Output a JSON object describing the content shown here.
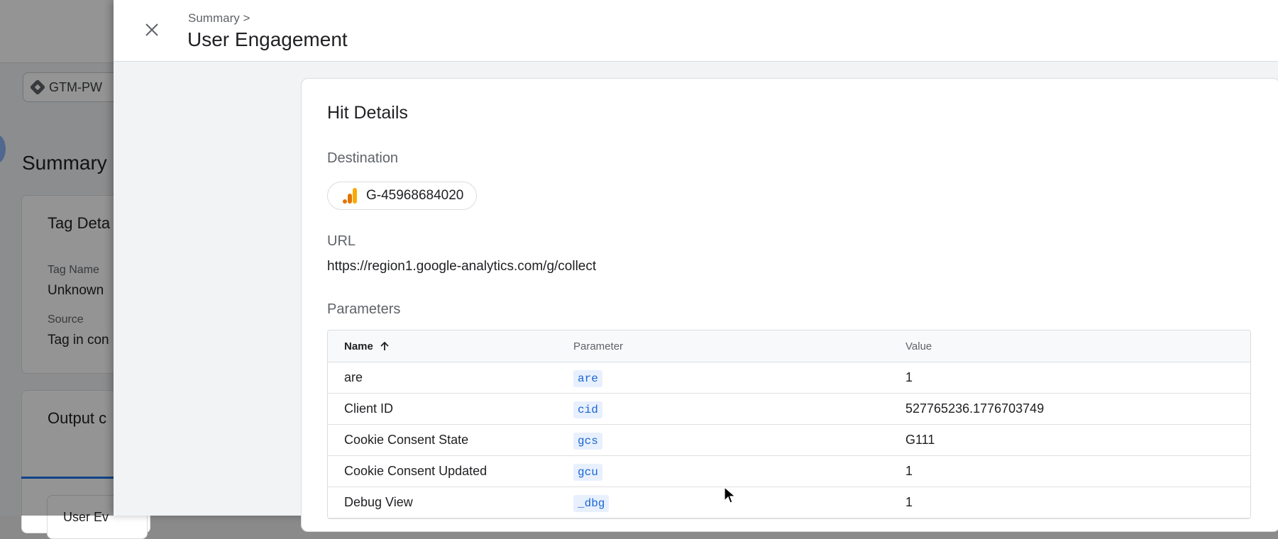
{
  "background": {
    "container_chip": "GTM-PW",
    "summary_title": "Summary",
    "tag_details_title": "Tag Deta",
    "tag_name_label": "Tag Name",
    "tag_name_value": "Unknown",
    "source_label": "Source",
    "source_value": "Tag in con",
    "output_title": "Output c",
    "subcard_text": "User Ev"
  },
  "panel": {
    "breadcrumb": "Summary >",
    "title": "User Engagement",
    "close_icon": "close-icon"
  },
  "hit_details": {
    "title": "Hit Details",
    "destination_label": "Destination",
    "destination_id": "G-45968684020",
    "destination_icon": "analytics-icon",
    "url_label": "URL",
    "url": "https://region1.google-analytics.com/g/collect",
    "parameters_label": "Parameters"
  },
  "table": {
    "headers": {
      "name": "Name",
      "parameter": "Parameter",
      "value": "Value"
    },
    "sort_icon": "arrow-up-icon",
    "rows": [
      {
        "name": "are",
        "parameter": "are",
        "value": "1"
      },
      {
        "name": "Client ID",
        "parameter": "cid",
        "value": "527765236.1776703749"
      },
      {
        "name": "Cookie Consent State",
        "parameter": "gcs",
        "value": "G111"
      },
      {
        "name": "Cookie Consent Updated",
        "parameter": "gcu",
        "value": "1"
      },
      {
        "name": "Debug View",
        "parameter": "_dbg",
        "value": "1"
      }
    ]
  },
  "colors": {
    "accent": "#1a73e8",
    "code_text": "#1967d2",
    "code_bg": "#e8f0fe",
    "analytics_orange": "#f9ab00",
    "analytics_dark_orange": "#e37400"
  }
}
